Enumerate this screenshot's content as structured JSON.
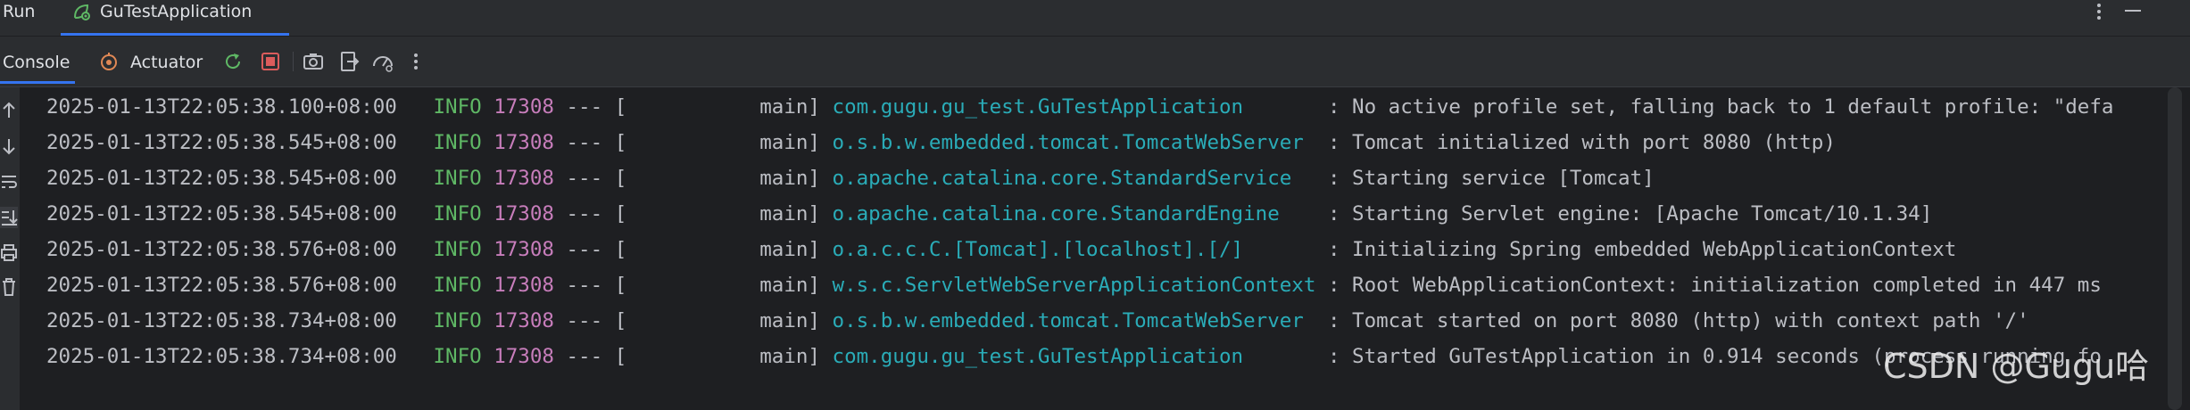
{
  "header": {
    "title": "Run",
    "tab_label": "GuTestApplication"
  },
  "toolbar": {
    "console_label": "Console",
    "actuator_label": "Actuator"
  },
  "colors": {
    "accent": "#3574f0",
    "level_info": "#5fb865",
    "pid": "#c77dbb",
    "logger": "#2aacb8",
    "stop_red": "#db5c5c",
    "rerun_green": "#5fb865"
  },
  "icons": {
    "tab": "spring-leaf-icon",
    "actuator": "actuator-icon",
    "rerun": "rerun-icon",
    "stop": "stop-icon",
    "screenshot": "camera-icon",
    "export": "export-icon",
    "profiler": "profiler-icon",
    "more": "more-vertical-icon",
    "minimize": "minimize-icon",
    "up": "arrow-up-icon",
    "down": "arrow-down-icon",
    "soft_wrap": "soft-wrap-icon",
    "scroll_end": "scroll-to-end-icon",
    "print": "print-icon",
    "clear": "trash-icon"
  },
  "console": {
    "lines": [
      {
        "ts": "2025-01-13T22:05:38.100+08:00",
        "level": " INFO",
        "pid": "17308",
        "sep": "---",
        "thread": "[           main]",
        "logger": "com.gugu.gu_test.GuTestApplication      ",
        "msg": ": No active profile set, falling back to 1 default profile: \"defa"
      },
      {
        "ts": "2025-01-13T22:05:38.545+08:00",
        "level": " INFO",
        "pid": "17308",
        "sep": "---",
        "thread": "[           main]",
        "logger": "o.s.b.w.embedded.tomcat.TomcatWebServer ",
        "msg": ": Tomcat initialized with port 8080 (http)"
      },
      {
        "ts": "2025-01-13T22:05:38.545+08:00",
        "level": " INFO",
        "pid": "17308",
        "sep": "---",
        "thread": "[           main]",
        "logger": "o.apache.catalina.core.StandardService  ",
        "msg": ": Starting service [Tomcat]"
      },
      {
        "ts": "2025-01-13T22:05:38.545+08:00",
        "level": " INFO",
        "pid": "17308",
        "sep": "---",
        "thread": "[           main]",
        "logger": "o.apache.catalina.core.StandardEngine   ",
        "msg": ": Starting Servlet engine: [Apache Tomcat/10.1.34]"
      },
      {
        "ts": "2025-01-13T22:05:38.576+08:00",
        "level": " INFO",
        "pid": "17308",
        "sep": "---",
        "thread": "[           main]",
        "logger": "o.a.c.c.C.[Tomcat].[localhost].[/]      ",
        "msg": ": Initializing Spring embedded WebApplicationContext"
      },
      {
        "ts": "2025-01-13T22:05:38.576+08:00",
        "level": " INFO",
        "pid": "17308",
        "sep": "---",
        "thread": "[           main]",
        "logger": "w.s.c.ServletWebServerApplicationContext",
        "msg": ": Root WebApplicationContext: initialization completed in 447 ms"
      },
      {
        "ts": "2025-01-13T22:05:38.734+08:00",
        "level": " INFO",
        "pid": "17308",
        "sep": "---",
        "thread": "[           main]",
        "logger": "o.s.b.w.embedded.tomcat.TomcatWebServer ",
        "msg": ": Tomcat started on port 8080 (http) with context path '/'"
      },
      {
        "ts": "2025-01-13T22:05:38.734+08:00",
        "level": " INFO",
        "pid": "17308",
        "sep": "---",
        "thread": "[           main]",
        "logger": "com.gugu.gu_test.GuTestApplication      ",
        "msg": ": Started GuTestApplication in 0.914 seconds (process running fo"
      }
    ]
  },
  "watermark": "CSDN @Gugu哈"
}
